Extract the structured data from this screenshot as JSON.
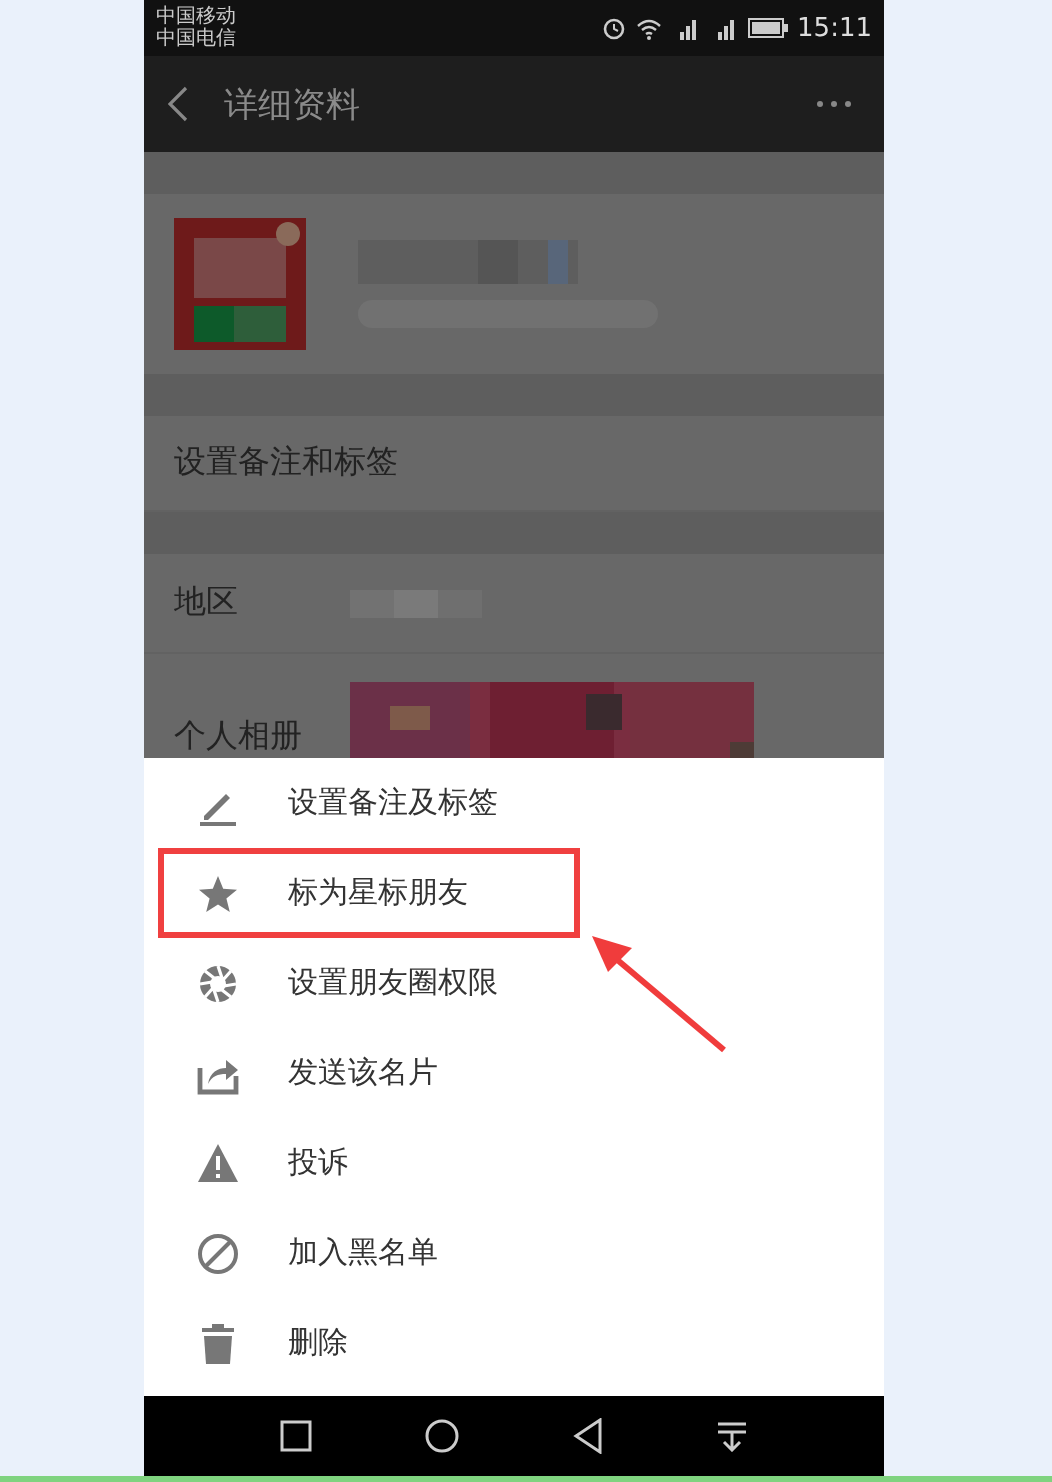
{
  "status_bar": {
    "carriers": [
      "中国移动",
      "中国电信"
    ],
    "time": "15:11"
  },
  "toolbar": {
    "title": "详细资料"
  },
  "rows": [
    {
      "kind": "link",
      "label": "设置备注和标签"
    },
    {
      "kind": "value",
      "label": "地区"
    },
    {
      "kind": "album",
      "label": "个人相册"
    }
  ],
  "menu": [
    {
      "kind": "pencil",
      "label": "设置备注及标签",
      "highlighted": false
    },
    {
      "kind": "star",
      "label": "标为星标朋友",
      "highlighted": true
    },
    {
      "kind": "aperture",
      "label": "设置朋友圈权限",
      "highlighted": false
    },
    {
      "kind": "share",
      "label": "发送该名片",
      "highlighted": false
    },
    {
      "kind": "warning",
      "label": "投诉",
      "highlighted": false
    },
    {
      "kind": "block",
      "label": "加入黑名单",
      "highlighted": false
    },
    {
      "kind": "trash",
      "label": "删除",
      "highlighted": false
    }
  ]
}
